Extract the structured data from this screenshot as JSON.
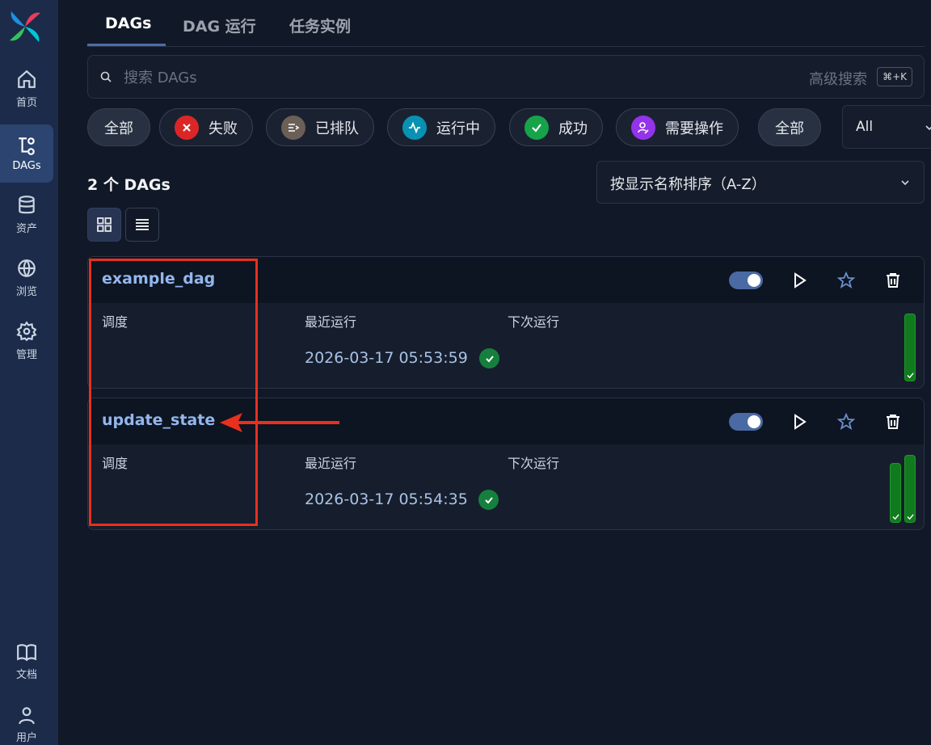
{
  "sidebar": {
    "items": [
      {
        "label": "首页",
        "icon": "home-icon"
      },
      {
        "label": "DAGs",
        "icon": "dags-icon",
        "active": true
      },
      {
        "label": "资产",
        "icon": "database-icon"
      },
      {
        "label": "浏览",
        "icon": "globe-icon"
      },
      {
        "label": "管理",
        "icon": "gear-icon"
      }
    ],
    "bottom": [
      {
        "label": "文档",
        "icon": "book-icon"
      },
      {
        "label": "用户",
        "icon": "user-icon"
      }
    ]
  },
  "tabs": [
    {
      "label": "DAGs",
      "active": true
    },
    {
      "label": "DAG 运行"
    },
    {
      "label": "任务实例"
    }
  ],
  "search": {
    "placeholder": "搜索 DAGs",
    "value": "",
    "advanced_label": "高级搜索",
    "shortcut": "⌘+K"
  },
  "filters": [
    {
      "label": "全部",
      "kind": "plain"
    },
    {
      "label": "失败",
      "icon": "x-icon",
      "color": "#dc2626"
    },
    {
      "label": "已排队",
      "icon": "queue-icon",
      "color": "#6b5f57"
    },
    {
      "label": "运行中",
      "icon": "activity-icon",
      "color": "#0891b2"
    },
    {
      "label": "成功",
      "icon": "check-icon",
      "color": "#16a34a"
    },
    {
      "label": "需要操作",
      "icon": "user-action-icon",
      "color": "#9333ea"
    },
    {
      "label": "全部",
      "kind": "plain"
    }
  ],
  "tag_select": {
    "value": "All"
  },
  "count_label": "2 个 DAGs",
  "sort": {
    "value": "按显示名称排序（A-Z）"
  },
  "view_mode": "card",
  "columns": {
    "schedule": "调度",
    "latest_run": "最近运行",
    "next_run": "下次运行"
  },
  "dags": [
    {
      "name": "example_dag",
      "enabled": true,
      "schedule": "",
      "latest_run": "2026-03-17 05:53:59",
      "latest_state": "success",
      "next_run": "",
      "recent_runs": [
        {
          "state": "success",
          "duration": 1.0
        }
      ]
    },
    {
      "name": "update_state",
      "enabled": true,
      "schedule": "",
      "latest_run": "2026-03-17 05:54:35",
      "latest_state": "success",
      "next_run": "",
      "recent_runs": [
        {
          "state": "success",
          "duration": 0.88
        },
        {
          "state": "success",
          "duration": 1.0
        }
      ]
    }
  ],
  "colors": {
    "accent": "#4b6ea9",
    "success": "#15803d",
    "annotation": "#e8301c",
    "dag_link": "#93b7ec"
  }
}
